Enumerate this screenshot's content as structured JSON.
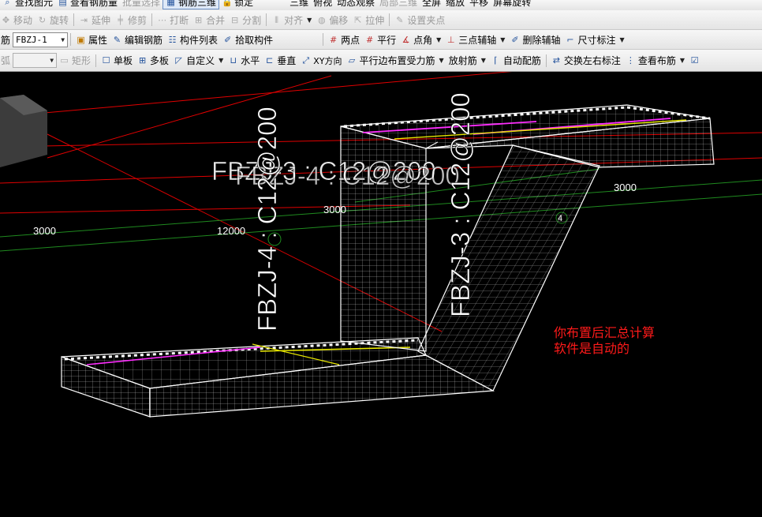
{
  "toolbar_top": {
    "items": [
      "查找图元",
      "查看钢筋量",
      "批量选择",
      "钢筋三维",
      "锁定",
      "三维",
      "俯视",
      "动态观察",
      "局部三维",
      "全屏",
      "缩放",
      "平移",
      "屏幕旋转"
    ]
  },
  "toolbar_edit": {
    "move": "移动",
    "rotate": "旋转",
    "extend": "延伸",
    "trim": "修剪",
    "break": "打断",
    "merge": "合并",
    "split": "分割",
    "align": "对齐",
    "offset": "偏移",
    "stretch": "拉伸",
    "set_grip": "设置夹点"
  },
  "toolbar_component": {
    "type_label": "筋",
    "component_name": "FBZJ-1",
    "properties": "属性",
    "edit_rebar": "编辑钢筋",
    "component_list": "构件列表",
    "pick_component": "拾取构件",
    "two_points": "两点",
    "parallel": "平行",
    "point_angle": "点角",
    "three_point_aux": "三点辅轴",
    "delete_aux": "删除辅轴",
    "dimension": "尺寸标注"
  },
  "toolbar_draw": {
    "arc": "弧",
    "rectangle": "矩形",
    "single_slab": "单板",
    "multi_slab": "多板",
    "custom": "自定义",
    "horizontal": "水平",
    "vertical": "垂直",
    "xy_direction": "XY方向",
    "parallel_edge": "平行边布置受力筋",
    "radial": "放射筋",
    "auto_rebar": "自动配筋",
    "swap_label": "交换左右标注",
    "view_layout": "查看布筋"
  },
  "canvas": {
    "dim_3000_left": "3000",
    "dim_12000": "12000",
    "dim_3000_mid": "3000",
    "dim_3000_right": "3000",
    "section_mark": "4",
    "label_horizontal": "FBZJ-3 : C12@200",
    "label_horizontal_overlap": "FBZJ-4 : C12@200",
    "label_vertical_left": "FBZJ-4 : C12@200",
    "label_vertical_right": "FBZJ-3 : C12@200",
    "annotation_line1": "你布置后汇总计算",
    "annotation_line2": "软件是自动的"
  },
  "colors": {
    "background": "#000000",
    "axis_red": "#e00000",
    "axis_green": "#1f8a1f",
    "wire": "#ffffff",
    "rebar_magenta": "#ff2dff",
    "rebar_yellow": "#e6e600",
    "annotation": "#ff1a1a"
  }
}
